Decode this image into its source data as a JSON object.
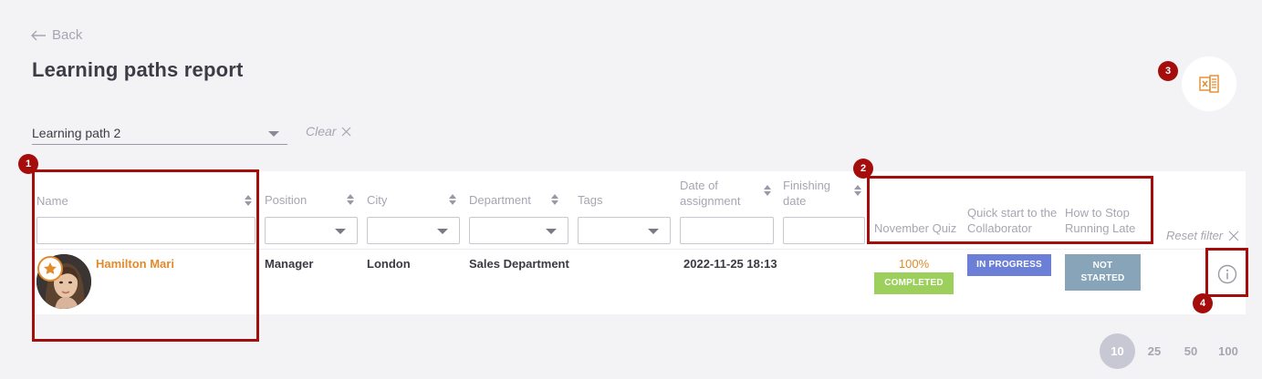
{
  "nav": {
    "back_label": "Back"
  },
  "page": {
    "title": "Learning paths report"
  },
  "filter": {
    "learning_path_value": "Learning path 2",
    "clear_label": "Clear"
  },
  "table": {
    "headers": {
      "name": "Name",
      "position": "Position",
      "city": "City",
      "department": "Department",
      "tags": "Tags",
      "date_of_assignment": "Date of assignment",
      "finishing_date": "Finishing date"
    },
    "course_columns": [
      "November Quiz",
      "Quick start to the Collaborator",
      "How to Stop Running Late"
    ],
    "reset_filter_label": "Reset filter",
    "rows": [
      {
        "name": "Hamilton Mari",
        "position": "Manager",
        "city": "London",
        "department": "Sales Department",
        "tags": "",
        "date_of_assignment": "2022-11-25 18:13",
        "finishing_date": "",
        "courses": [
          {
            "percent": "100%",
            "status": "COMPLETED",
            "color": "#9ccf5b"
          },
          {
            "status": "IN PROGRESS",
            "color": "#6b7fd7"
          },
          {
            "status": "NOT STARTED",
            "color": "#88a4b8"
          }
        ]
      }
    ]
  },
  "pagination": {
    "options": [
      "10",
      "25",
      "50",
      "100"
    ],
    "selected": "10"
  },
  "annotations": {
    "badges": [
      "1",
      "2",
      "3",
      "4"
    ]
  },
  "colors": {
    "accent": "#e38b2c",
    "highlight": "#a50d0d",
    "muted": "#a6a6b2"
  },
  "icons": {
    "back": "arrow-left-icon",
    "export": "excel-export-icon",
    "info": "info-icon",
    "featured": "star-icon",
    "close": "close-icon"
  }
}
